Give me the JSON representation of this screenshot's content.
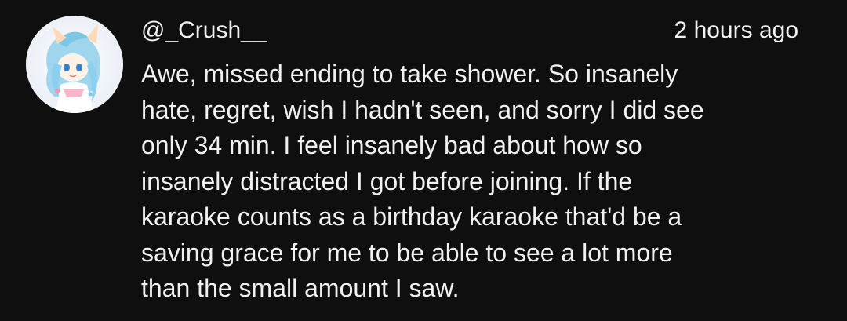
{
  "comment": {
    "author": "@_Crush__",
    "timestamp": "2 hours ago",
    "avatar_icon": "anime-character-avatar-icon",
    "text_lines": [
      "Awe, missed ending to take shower. So insanely",
      "hate, regret, wish I hadn't seen, and sorry I did see",
      "only 34 min. I feel insanely bad about how so",
      "insanely distracted I got before joining. If the",
      "karaoke counts as a birthday karaoke that'd be a",
      "saving grace for me to be able to see a lot more",
      "than the small amount I saw."
    ]
  },
  "colors": {
    "background": "#0f0f0f",
    "text": "#f1f1f1"
  }
}
